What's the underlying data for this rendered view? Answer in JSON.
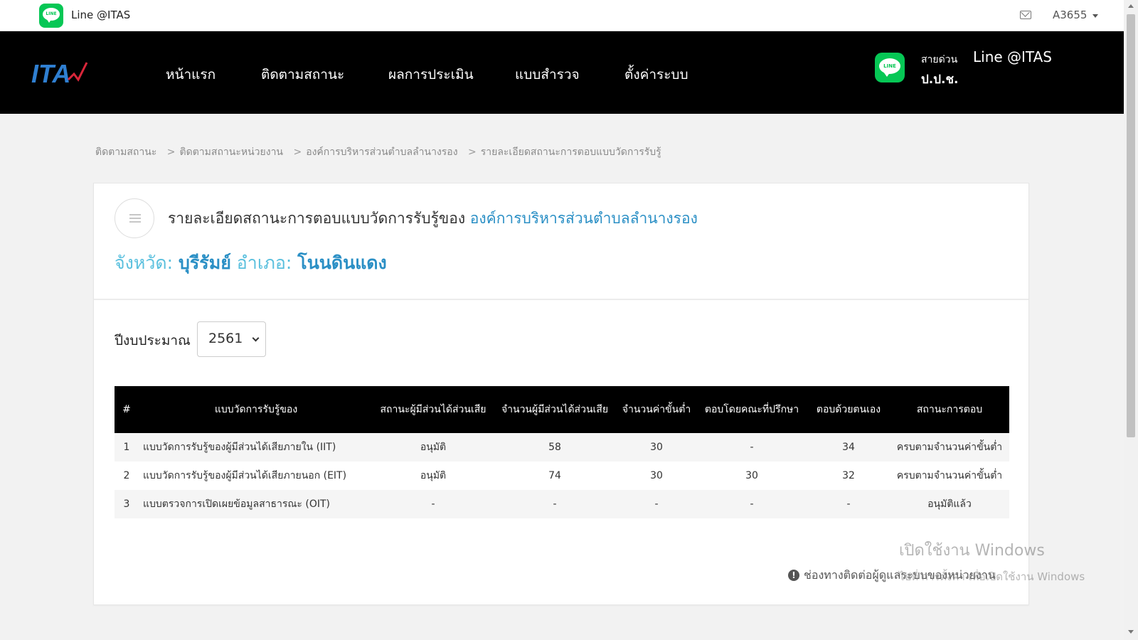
{
  "topbar": {
    "brand": "Line @ITAS",
    "user": "A3655",
    "icons": {
      "line_logo": "line-logo-icon",
      "mail": "mail-icon",
      "caret": "caret-down-icon"
    }
  },
  "nav": {
    "logo_text": "ITA",
    "items": [
      "หน้าแรก",
      "ติดตามสถานะ",
      "ผลการประเมิน",
      "แบบสำรวจ",
      "ตั้งค่าระบบ"
    ],
    "hotline_label": "สายด่วน",
    "hotline_name": "Line @ITAS",
    "hotline_org": "ป.ป.ช."
  },
  "breadcrumb": [
    "ติดตามสถานะ",
    "ติดตามสถานะหน่วยงาน",
    "องค์การบริหารส่วนตำบลลำนางรอง",
    "รายละเอียดสถานะการตอบแบบวัดการรับรู้"
  ],
  "breadcrumb_sep": ">",
  "header": {
    "title_prefix": "รายละเอียดสถานะการตอบแบบวัดการรับรู้ของ",
    "org": "องค์การบริหารส่วนตำบลลำนางรอง",
    "province_label": "จังหวัด:",
    "province": "บุรีรัมย์",
    "district_label": "อำเภอ:",
    "district": "โนนดินแดง"
  },
  "filter": {
    "year_label": "ปีงบประมาณ",
    "year_value": "2561"
  },
  "table": {
    "columns": [
      "#",
      "แบบวัดการรับรู้ของ",
      "สถานะผู้มีส่วนได้ส่วนเสีย",
      "จำนวนผู้มีส่วนได้ส่วนเสีย",
      "จำนวนค่าขั้นต่ำ",
      "ตอบโดยคณะที่ปรึกษา",
      "ตอบด้วยตนเอง",
      "สถานะการตอบ"
    ],
    "rows": [
      [
        "1",
        "แบบวัดการรับรู้ของผู้มีส่วนได้เสียภายใน (IIT)",
        "อนุมัติ",
        "58",
        "30",
        "-",
        "34",
        "ครบตามจำนวนค่าขั้นต่ำ"
      ],
      [
        "2",
        "แบบวัดการรับรู้ของผู้มีส่วนได้เสียภายนอก (EIT)",
        "อนุมัติ",
        "74",
        "30",
        "30",
        "32",
        "ครบตามจำนวนค่าขั้นต่ำ"
      ],
      [
        "3",
        "แบบตรวจการเปิดเผยข้อมูลสาธารณะ (OIT)",
        "-",
        "-",
        "-",
        "-",
        "-",
        "อนุมัติแล้ว"
      ]
    ]
  },
  "contact_link": "ช่องทางติดต่อผู้ดูแลระบบของหน่วยงาน",
  "watermark": {
    "line1": "เปิดใช้งาน Windows",
    "line2": "ไปที่ การตั้งค่า เพื่อเปิดใช้งาน Windows"
  },
  "colors": {
    "nav_bg": "#000000",
    "line_green": "#06c755",
    "link_blue": "#2a8fc5",
    "label_cyan": "#5bc0de"
  }
}
